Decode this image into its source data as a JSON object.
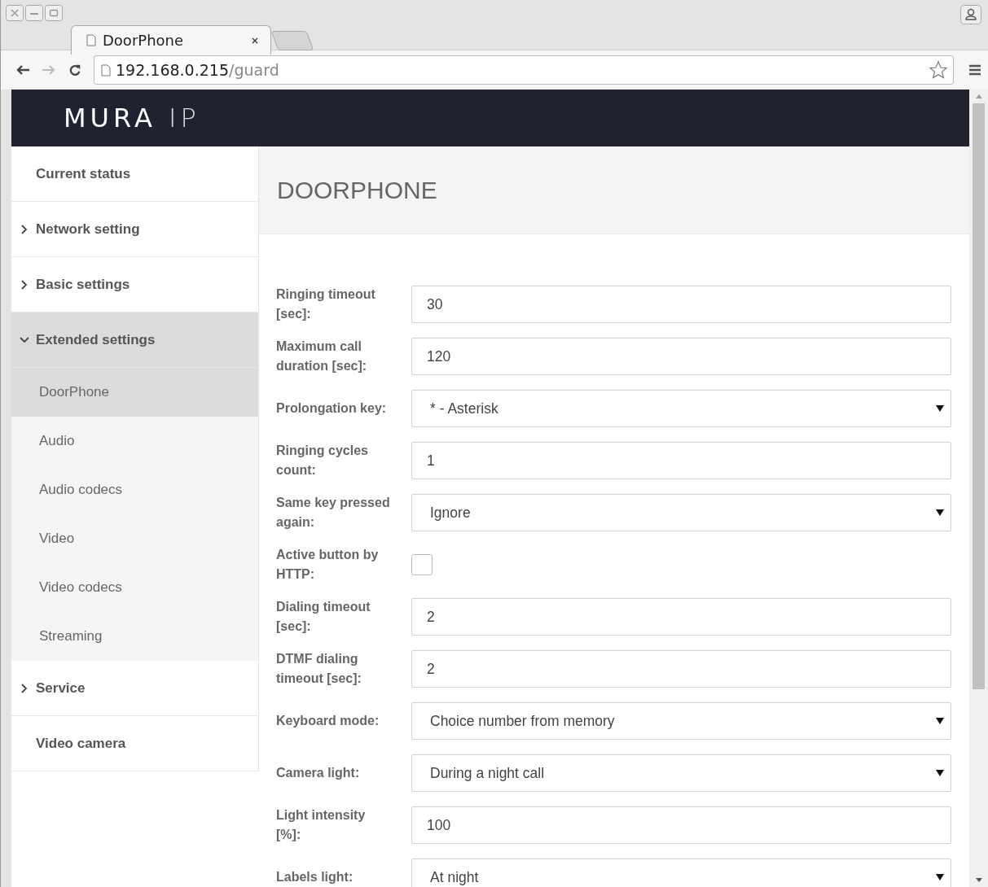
{
  "browser": {
    "tab_title": "DoorPhone",
    "url_host": "192.168.0.215",
    "url_path": "/guard"
  },
  "brand": {
    "name": "MURA",
    "suffix": "IP"
  },
  "sidebar": {
    "items": [
      {
        "kind": "item",
        "label": "Current status"
      },
      {
        "kind": "group",
        "label": "Network setting",
        "expanded": false
      },
      {
        "kind": "group",
        "label": "Basic settings",
        "expanded": false
      },
      {
        "kind": "group",
        "label": "Extended settings",
        "expanded": true,
        "children": [
          {
            "label": "DoorPhone",
            "selected": true
          },
          {
            "label": "Audio",
            "selected": false
          },
          {
            "label": "Audio codecs",
            "selected": false
          },
          {
            "label": "Video",
            "selected": false
          },
          {
            "label": "Video codecs",
            "selected": false
          },
          {
            "label": "Streaming",
            "selected": false
          }
        ]
      },
      {
        "kind": "group",
        "label": "Service",
        "expanded": false
      },
      {
        "kind": "item",
        "label": "Video camera"
      }
    ]
  },
  "page": {
    "title": "DOORPHONE"
  },
  "fields": [
    {
      "kind": "text",
      "label": "Ringing timeout [sec]:",
      "value": "30"
    },
    {
      "kind": "text",
      "label": "Maximum call duration [sec]:",
      "value": "120"
    },
    {
      "kind": "select",
      "label": "Prolongation key:",
      "value": "* - Asterisk"
    },
    {
      "kind": "text",
      "label": "Ringing cycles count:",
      "value": "1"
    },
    {
      "kind": "select",
      "label": "Same key pressed again:",
      "value": "Ignore"
    },
    {
      "kind": "checkbox",
      "label": "Active button by HTTP:",
      "checked": false
    },
    {
      "kind": "text",
      "label": "Dialing timeout [sec]:",
      "value": "2"
    },
    {
      "kind": "text",
      "label": "DTMF dialing timeout [sec]:",
      "value": "2"
    },
    {
      "kind": "select",
      "label": "Keyboard mode:",
      "value": "Choice number from memory"
    },
    {
      "kind": "select",
      "label": "Camera light:",
      "value": "During a night call"
    },
    {
      "kind": "text",
      "label": "Light intensity [%]:",
      "value": "100"
    },
    {
      "kind": "select",
      "label": "Labels light:",
      "value": "At night"
    }
  ]
}
